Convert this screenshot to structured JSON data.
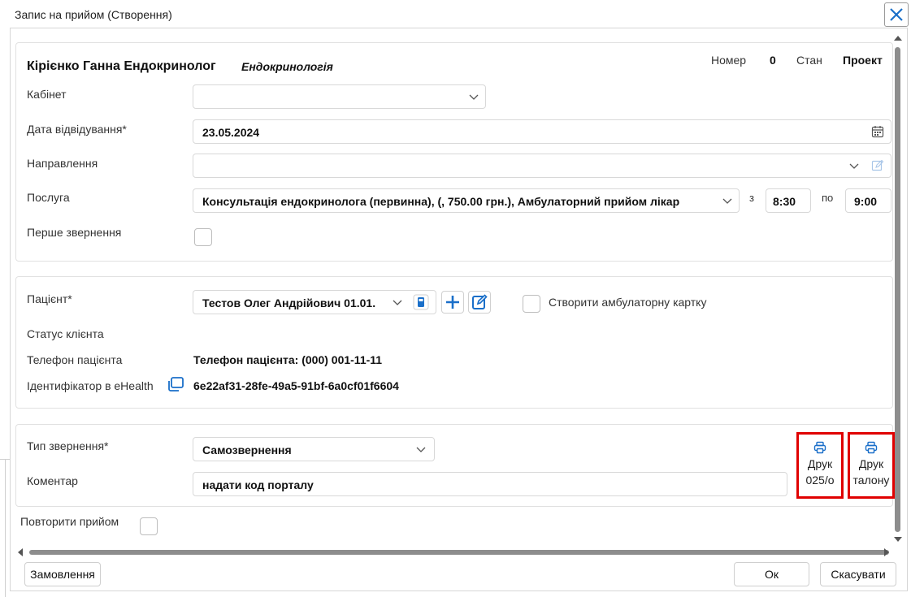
{
  "window": {
    "title": "Запис на прийом (Створення)"
  },
  "header": {
    "doctor": "Кірієнко Ганна Ендокринолог",
    "specialty": "Ендокринологія",
    "number_label": "Номер",
    "number_value": "0",
    "state_label": "Стан",
    "state_value": "Проект"
  },
  "form": {
    "cabinet_label": "Кабінет",
    "cabinet_value": "",
    "visit_date_label": "Дата відвідування*",
    "visit_date_value": "23.05.2024",
    "referral_label": "Направлення",
    "referral_value": "",
    "service_label": "Послуга",
    "service_value": "Консультація ендокринолога (первинна), (, 750.00 грн.), Амбулаторний прийом лікар",
    "time_from_label": "з",
    "time_from_value": "8:30",
    "time_to_label": "по",
    "time_to_value": "9:00",
    "first_visit_label": "Перше звернення"
  },
  "patient": {
    "patient_label": "Пацієнт*",
    "patient_value": "Тестов Олег Андрійович 01.01.",
    "create_card_label": "Створити амбулаторну картку",
    "client_status_label": "Статус клієнта",
    "phone_label": "Телефон пацієнта",
    "phone_value": "Телефон пацієнта: (000) 001-11-11",
    "ehealth_label": "Ідентифікатор в eHealth",
    "ehealth_value": "6e22af31-28fe-49a5-91bf-6a0cf01f6604"
  },
  "visit": {
    "appeal_type_label": "Тип звернення*",
    "appeal_type_value": "Самозвернення",
    "comment_label": "Коментар",
    "comment_value": "надати код порталу",
    "print_025_line1": "Друк",
    "print_025_line2": "025/о",
    "print_ticket_line1": "Друк",
    "print_ticket_line2": "талону"
  },
  "repeat_label": "Повторити прийом",
  "footer": {
    "orders_label": "Замовлення",
    "ok_label": "Ок",
    "cancel_label": "Скасувати"
  },
  "colors": {
    "accent": "#1a6fc9",
    "highlight": "#e00000"
  }
}
